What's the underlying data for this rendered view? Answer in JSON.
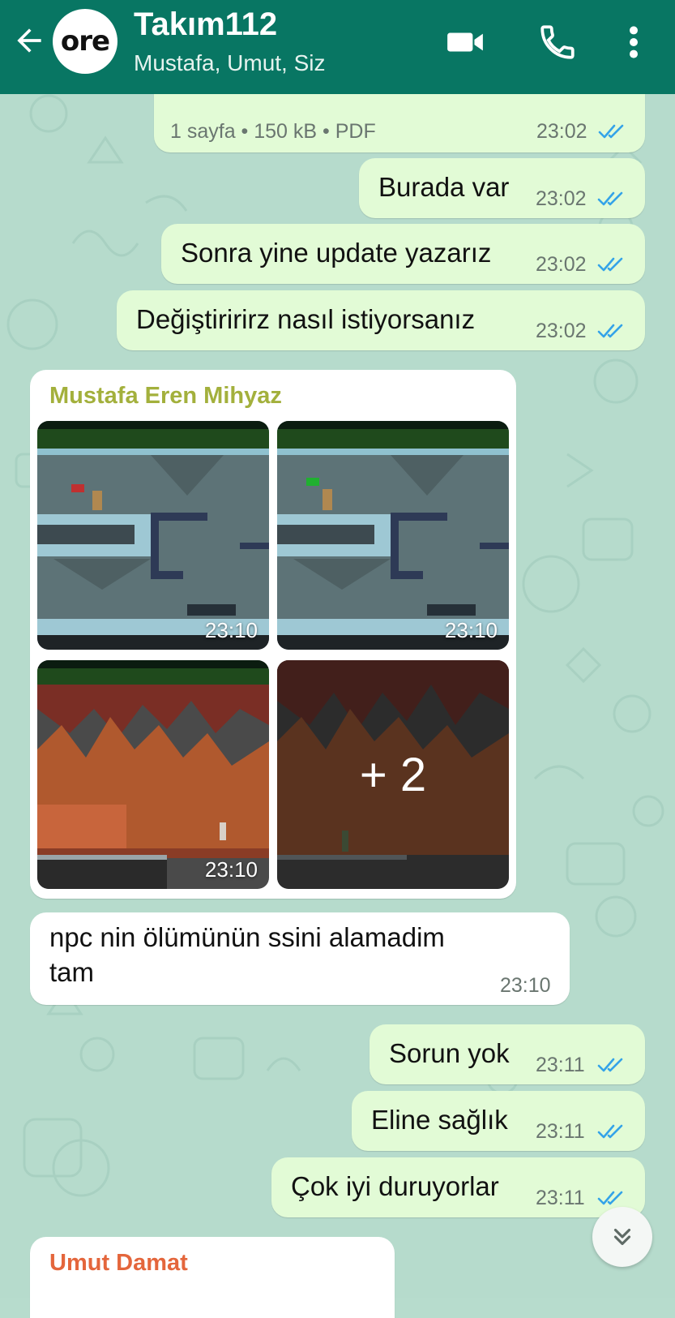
{
  "header": {
    "avatar_text": "ore",
    "title": "Takım112",
    "subtitle": "Mustafa, Umut, Siz",
    "colors": {
      "bar": "#087663"
    }
  },
  "icons": {
    "back": "arrow-left-icon",
    "video": "video-camera-icon",
    "call": "phone-icon",
    "menu": "more-vertical-icon",
    "read_receipt": "double-check-icon",
    "scroll_down": "chevrons-down-icon"
  },
  "messages": {
    "doc": {
      "meta": "1 sayfa • 150 kB • PDF",
      "time": "23:02"
    },
    "m1": {
      "text": "Burada var",
      "time": "23:02"
    },
    "m2": {
      "text": "Sonra yine update yazarız",
      "time": "23:02"
    },
    "m3": {
      "text": "Değiştiririrz nasıl istiyorsanız",
      "time": "23:02"
    },
    "album": {
      "sender": "Mustafa Eren Mihyaz",
      "sender_color": "#a3b03c",
      "photos": [
        {
          "time": "23:10"
        },
        {
          "time": "23:10"
        },
        {
          "time": "23:10"
        }
      ],
      "more_count": "+ 2"
    },
    "m4": {
      "line1": "npc nin ölümünün ssini alamadim",
      "line2": "tam",
      "time": "23:10"
    },
    "m5": {
      "text": "Sorun yok",
      "time": "23:11"
    },
    "m6": {
      "text": "Eline sağlık",
      "time": "23:11"
    },
    "m7": {
      "text": "Çok iyi duruyorlar",
      "time": "23:11"
    },
    "last": {
      "sender": "Umut Damat",
      "sender_color": "#e4663c"
    }
  }
}
